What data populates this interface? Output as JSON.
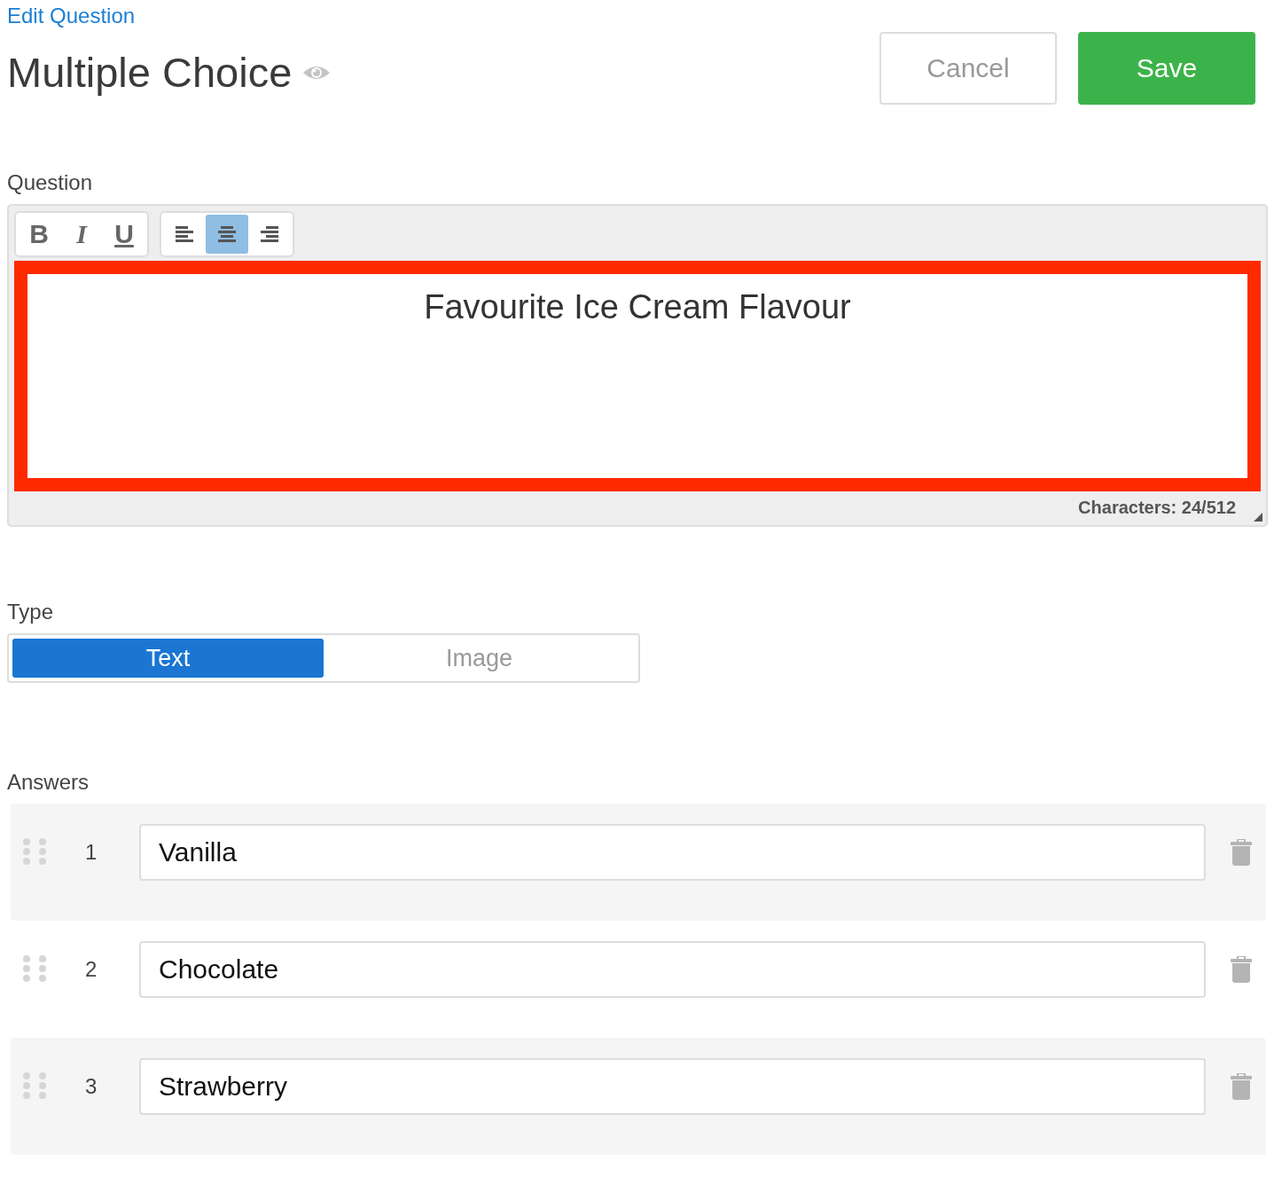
{
  "breadcrumb": "Edit Question",
  "title": "Multiple Choice",
  "buttons": {
    "cancel": "Cancel",
    "save": "Save"
  },
  "question": {
    "label": "Question",
    "format_buttons": [
      {
        "label": "B",
        "kind": "bold",
        "active": false
      },
      {
        "label": "I",
        "kind": "italic",
        "active": false
      },
      {
        "label": "U",
        "kind": "underline",
        "active": false
      }
    ],
    "align_buttons": [
      {
        "kind": "left",
        "selected": false
      },
      {
        "kind": "center",
        "selected": true
      },
      {
        "kind": "right",
        "selected": false
      }
    ],
    "text": "Favourite Ice Cream Flavour",
    "highlighted": true,
    "counter": "Characters: 24/512"
  },
  "type": {
    "label": "Type",
    "options": [
      {
        "label": "Text",
        "selected": true
      },
      {
        "label": "Image",
        "selected": false
      }
    ]
  },
  "answers": {
    "label": "Answers",
    "items": [
      {
        "number": "1",
        "value": "Vanilla"
      },
      {
        "number": "2",
        "value": "Chocolate"
      },
      {
        "number": "3",
        "value": "Strawberry"
      }
    ]
  }
}
